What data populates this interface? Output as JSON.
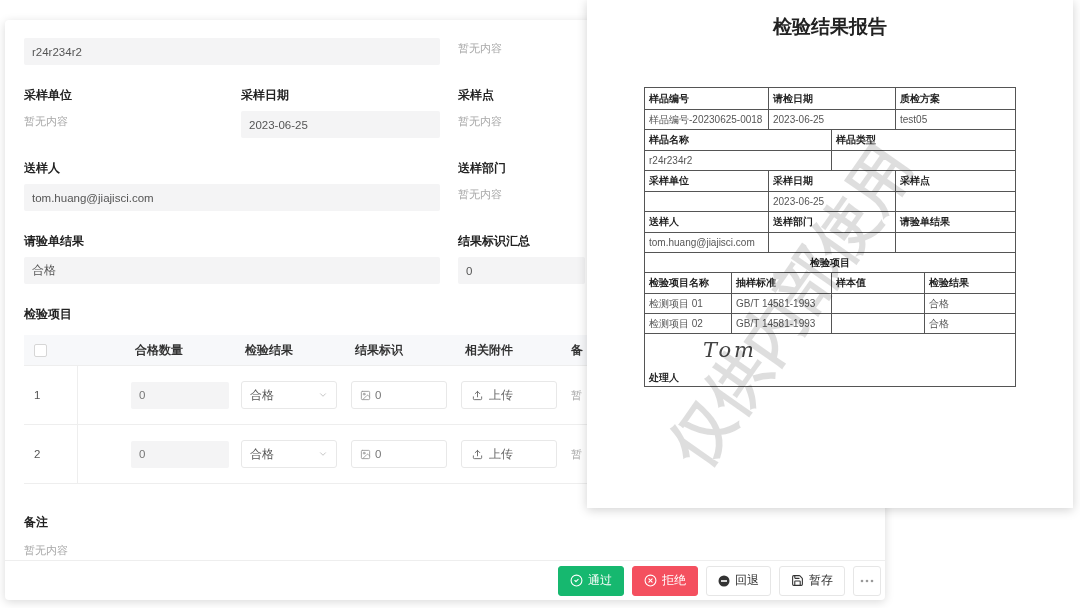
{
  "form": {
    "fields": [
      {
        "kind": "wide",
        "value": "r24r234r2"
      },
      {
        "kind": "empty",
        "value": "暂无内容"
      },
      {
        "label": "采样单位",
        "kind": "empty",
        "value": "暂无内容"
      },
      {
        "label": "采样日期",
        "kind": "field",
        "value": "2023-06-25"
      },
      {
        "label": "采样点",
        "kind": "empty",
        "value": "暂无内容"
      },
      {
        "label": "送样人",
        "kind": "wide",
        "value": "tom.huang@jiajisci.com"
      },
      {
        "label": "送样部门",
        "kind": "empty",
        "value": "暂无内容"
      },
      {
        "label": "请验单结果",
        "kind": "wide",
        "value": "合格"
      },
      {
        "label": "结果标识汇总",
        "kind": "field",
        "value": "0"
      }
    ],
    "items_title": "检验项目",
    "table": {
      "select_all_checked": false,
      "columns": [
        "合格数量",
        "检验结果",
        "结果标识",
        "相关附件",
        "备"
      ],
      "rows": [
        {
          "index": "1",
          "quantity": "0",
          "result": "合格",
          "mark": "0",
          "upload": "上传",
          "note": "暂"
        },
        {
          "index": "2",
          "quantity": "0",
          "result": "合格",
          "mark": "0",
          "upload": "上传",
          "note": "暂"
        }
      ]
    },
    "remarks": {
      "label": "备注",
      "value": "暂无内容"
    },
    "actions": [
      {
        "kind": "approve",
        "label": "通过"
      },
      {
        "kind": "reject",
        "label": "拒绝"
      },
      {
        "kind": "back",
        "label": "回退"
      },
      {
        "kind": "save",
        "label": "暂存"
      },
      {
        "kind": "more"
      }
    ]
  },
  "report": {
    "title": "检验结果报告",
    "rows": [
      {
        "kind": "head",
        "cells": [
          "样品编号",
          "请检日期",
          "质检方案"
        ]
      },
      {
        "kind": "value",
        "cells": [
          "样品编号-20230625-0018",
          "2023-06-25",
          "test05"
        ]
      },
      {
        "kind": "head",
        "cells": [
          "样品名称",
          "样品类型"
        ]
      },
      {
        "kind": "value",
        "cells": [
          "r24r234r2",
          ""
        ]
      },
      {
        "kind": "head",
        "cells": [
          "采样单位",
          "采样日期",
          "采样点"
        ]
      },
      {
        "kind": "value",
        "cells": [
          "",
          "2023-06-25",
          ""
        ]
      },
      {
        "kind": "head",
        "cells": [
          "送样人",
          "送样部门",
          "请验单结果"
        ]
      },
      {
        "kind": "value",
        "cells": [
          "tom.huang@jiajisci.com",
          "",
          ""
        ]
      },
      {
        "kind": "section",
        "cells": [
          "检验项目"
        ]
      },
      {
        "kind": "head",
        "cells": [
          "检验项目名称",
          "抽样标准",
          "样本值",
          "检验结果"
        ]
      },
      {
        "kind": "value",
        "cells": [
          "检测项目 01",
          "GB/T 14581-1993",
          "",
          "合格"
        ]
      },
      {
        "kind": "value",
        "cells": [
          "检测项目 02",
          "GB/T 14581-1993",
          "",
          "合格"
        ]
      }
    ],
    "signature": "Tom",
    "handler_label": "处理人",
    "watermark": "仅供内部使用"
  }
}
